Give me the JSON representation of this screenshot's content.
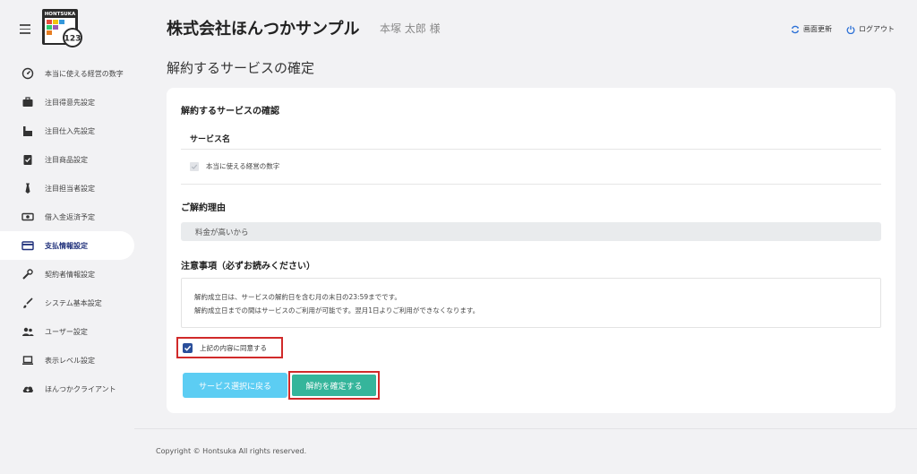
{
  "sidebar": {
    "logo_text": "HONTSUKA",
    "logo_number": "123",
    "items": [
      {
        "label": "本当に使える経営の数字",
        "icon": "gauge-icon"
      },
      {
        "label": "注目得意先設定",
        "icon": "briefcase-icon"
      },
      {
        "label": "注目仕入先設定",
        "icon": "factory-icon"
      },
      {
        "label": "注目商品設定",
        "icon": "clipboard-check-icon"
      },
      {
        "label": "注目担当者設定",
        "icon": "necktie-icon"
      },
      {
        "label": "借入金返済予定",
        "icon": "money-icon"
      },
      {
        "label": "支払情報設定",
        "icon": "credit-card-icon"
      },
      {
        "label": "契約者情報設定",
        "icon": "wrench-icon"
      },
      {
        "label": "システム基本設定",
        "icon": "brush-icon"
      },
      {
        "label": "ユーザー設定",
        "icon": "users-icon"
      },
      {
        "label": "表示レベル設定",
        "icon": "laptop-icon"
      },
      {
        "label": "ほんつかクライアント",
        "icon": "cloud-download-icon"
      }
    ]
  },
  "header": {
    "company": "株式会社ほんつかサンプル",
    "user": "本塚 太郎 様",
    "refresh_label": "画面更新",
    "logout_label": "ログアウト"
  },
  "page": {
    "title": "解約するサービスの確定"
  },
  "card": {
    "services_title": "解約するサービスの確認",
    "services_header": "サービス名",
    "service_item": "本当に使える経営の数字",
    "reason_title": "ご解約理由",
    "reason_value": "料金が高いから",
    "notice_title": "注意事項（必ずお読みください）",
    "notice_line1": "解約成立日は、サービスの解約日を含む月の末日の23:59までです。",
    "notice_line2": "解約成立日までの間はサービスのご利用が可能です。翌月1日よりご利用ができなくなります。",
    "agree_label": "上記の内容に同意する",
    "back_button": "サービス選択に戻る",
    "confirm_button": "解約を確定する"
  },
  "footer": {
    "copyright": "Copyright © Hontsuka All rights reserved."
  },
  "colors": {
    "active_nav": "#1e2f7a",
    "back_button": "#5ccdf3",
    "confirm_button": "#35b59b",
    "highlight_border": "#d12a2a",
    "checkbox": "#2a4f9b"
  }
}
